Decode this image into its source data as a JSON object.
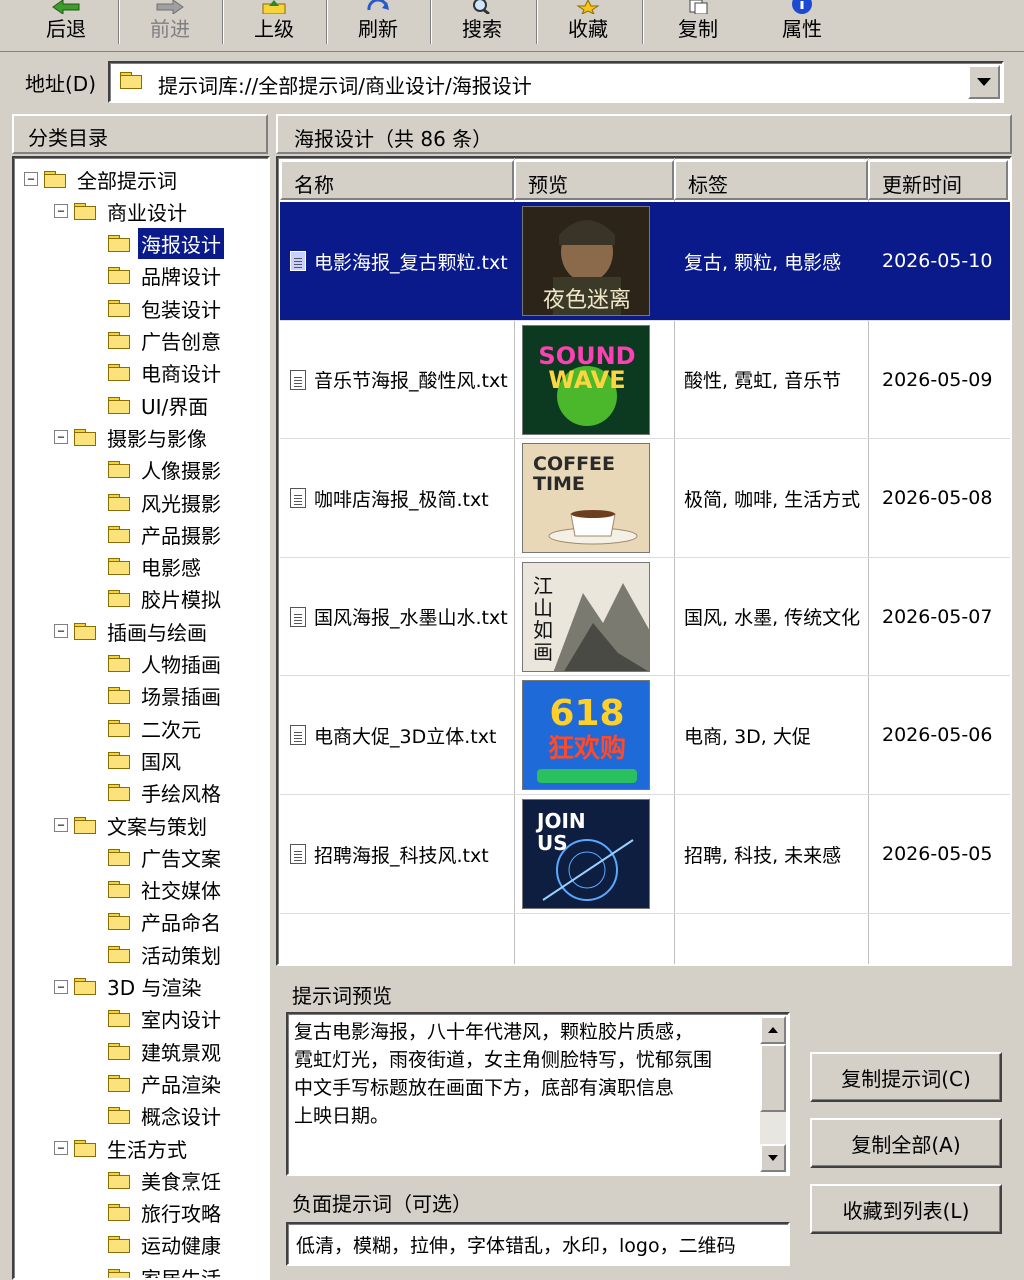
{
  "toolbar": {
    "back": "后退",
    "forward": "前进",
    "up": "上级",
    "refresh": "刷新",
    "search": "搜索",
    "favorite": "收藏",
    "copy": "复制",
    "properties": "属性"
  },
  "address": {
    "label": "地址(D)",
    "path": "提示词库://全部提示词/商业设计/海报设计"
  },
  "tree": {
    "header": "分类目录",
    "root": "全部提示词",
    "groups": [
      {
        "label": "商业设计",
        "children": [
          "海报设计",
          "品牌设计",
          "包装设计",
          "广告创意",
          "电商设计",
          "UI/界面"
        ]
      },
      {
        "label": "摄影与影像",
        "children": [
          "人像摄影",
          "风光摄影",
          "产品摄影",
          "电影感",
          "胶片模拟"
        ]
      },
      {
        "label": "插画与绘画",
        "children": [
          "人物插画",
          "场景插画",
          "二次元",
          "国风",
          "手绘风格"
        ]
      },
      {
        "label": "文案与策划",
        "children": [
          "广告文案",
          "社交媒体",
          "产品命名",
          "活动策划"
        ]
      },
      {
        "label": "3D 与渲染",
        "children": [
          "室内设计",
          "建筑景观",
          "产品渲染",
          "概念设计"
        ]
      },
      {
        "label": "生活方式",
        "children": [
          "美食烹饪",
          "旅行攻略",
          "运动健康",
          "家居生活"
        ]
      }
    ],
    "selected": "海报设计"
  },
  "list": {
    "title": "海报设计（共 86 条）",
    "columns": [
      "名称",
      "预览",
      "标签",
      "更新时间"
    ],
    "rows": [
      {
        "name": "电影海报_复古颗粒.txt",
        "tags": "复古, 颗粒, 电影感",
        "date": "2026-05-10",
        "thumb_text": "夜色迷离",
        "selected": true
      },
      {
        "name": "音乐节海报_酸性风.txt",
        "tags": "酸性, 霓虹, 音乐节",
        "date": "2026-05-09",
        "thumb_text": "SOUND WAVE"
      },
      {
        "name": "咖啡店海报_极简.txt",
        "tags": "极简, 咖啡, 生活方式",
        "date": "2026-05-08",
        "thumb_text": "COFFEE TIME"
      },
      {
        "name": "国风海报_水墨山水.txt",
        "tags": "国风, 水墨, 传统文化",
        "date": "2026-05-07",
        "thumb_text": "江山如画"
      },
      {
        "name": "电商大促_3D立体.txt",
        "tags": "电商, 3D, 大促",
        "date": "2026-05-06",
        "thumb_text": "618 狂欢购"
      },
      {
        "name": "招聘海报_科技风.txt",
        "tags": "招聘, 科技, 未来感",
        "date": "2026-05-05",
        "thumb_text": "JOIN US"
      }
    ]
  },
  "preview": {
    "title": "提示词预览",
    "prompt": "复古电影海报，八十年代港风，颗粒胶片质感，\n霓虹灯光，雨夜街道，女主角侧脸特写，忧郁氛围\n中文手写标题放在画面下方，底部有演职信息\n上映日期。",
    "negative_title": "负面提示词（可选）",
    "negative": "低清，模糊，拉伸，字体错乱，水印，logo，二维码"
  },
  "actions": {
    "copy_prompt": "复制提示词(C)",
    "copy_all": "复制全部(A)",
    "add_favorite": "收藏到列表(L)"
  },
  "colors": {
    "selection": "#0a1a8a",
    "window_bg": "#d4d0c8"
  }
}
